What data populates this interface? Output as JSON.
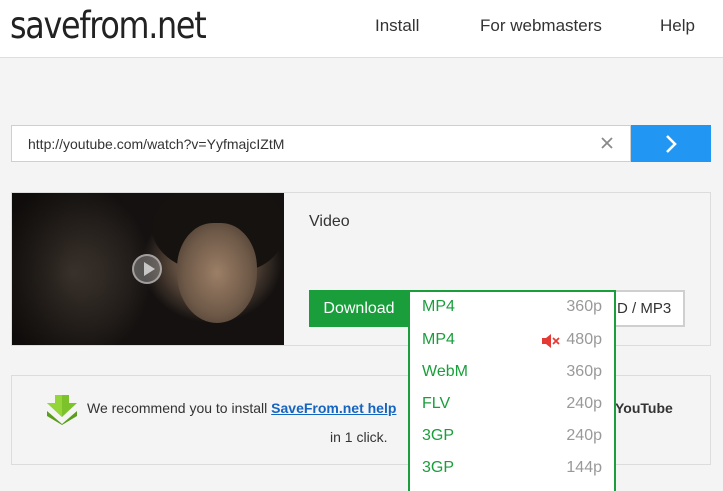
{
  "header": {
    "logo": "savefrom.net",
    "nav": [
      {
        "label": "Install"
      },
      {
        "label": "For webmasters"
      },
      {
        "label": "Help"
      }
    ]
  },
  "search": {
    "url_value": "http://youtube.com/watch?v=YyfmajcIZtM"
  },
  "result": {
    "title": "Video",
    "download_label": "Download",
    "hd_label": "D / MP3"
  },
  "formats": [
    {
      "format": "MP4",
      "resolution": "360p",
      "muted": false
    },
    {
      "format": "MP4",
      "resolution": "480p",
      "muted": true
    },
    {
      "format": "WebM",
      "resolution": "360p",
      "muted": false
    },
    {
      "format": "FLV",
      "resolution": "240p",
      "muted": false
    },
    {
      "format": "3GP",
      "resolution": "240p",
      "muted": false
    },
    {
      "format": "3GP",
      "resolution": "144p",
      "muted": false
    }
  ],
  "recommend": {
    "text": "We recommend you to install",
    "link": "SaveFrom.net help",
    "youtube": "YouTube",
    "line2": "in 1 click."
  },
  "colors": {
    "accent_blue": "#2196f3",
    "accent_green": "#1a9e3c",
    "mute_red": "#e53935"
  }
}
